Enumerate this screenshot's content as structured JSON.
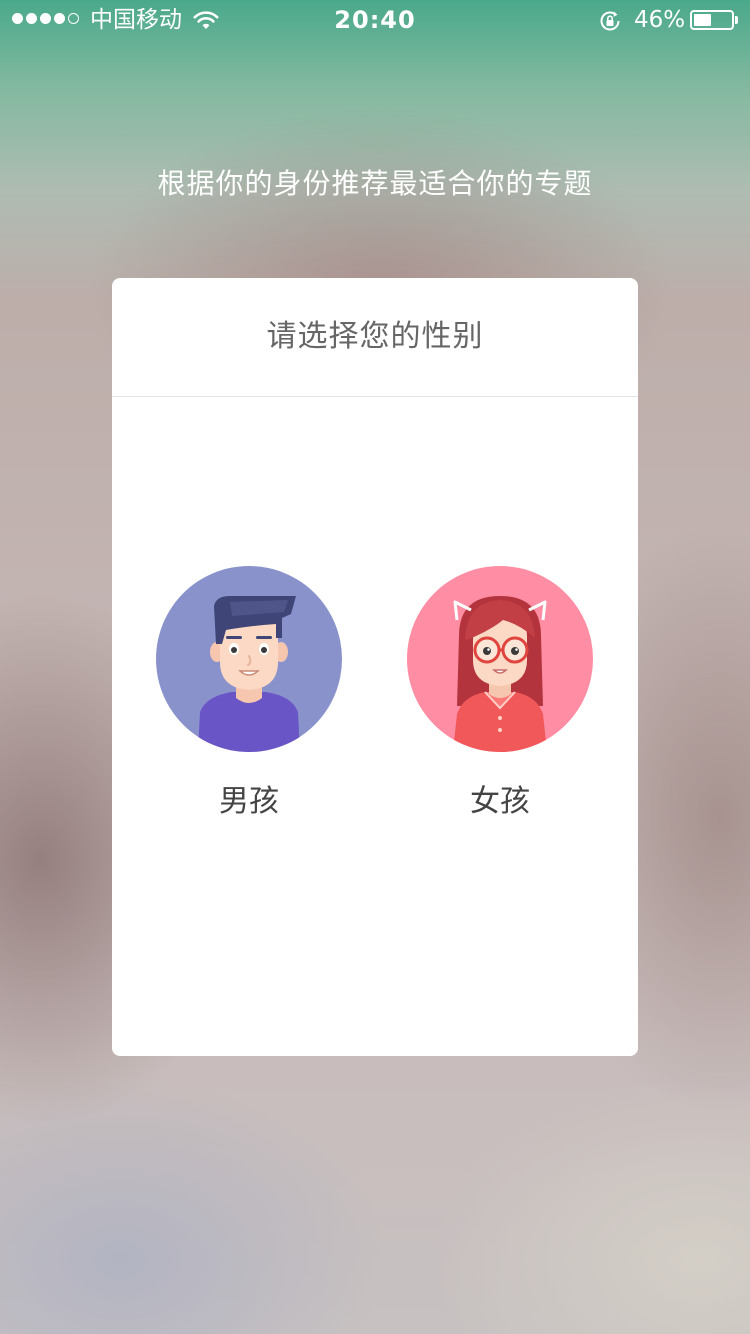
{
  "status_bar": {
    "carrier": "中国移动",
    "time": "20:40",
    "battery_percent": "46%",
    "battery_level": 0.46,
    "signal_strength": 4,
    "signal_max": 5
  },
  "subtitle": "根据你的身份推荐最适合你的专题",
  "dialog": {
    "title": "请选择您的性别",
    "options": [
      {
        "label": "男孩",
        "avatar_color": "#8a92cc"
      },
      {
        "label": "女孩",
        "avatar_color": "#ff8da3"
      }
    ]
  }
}
